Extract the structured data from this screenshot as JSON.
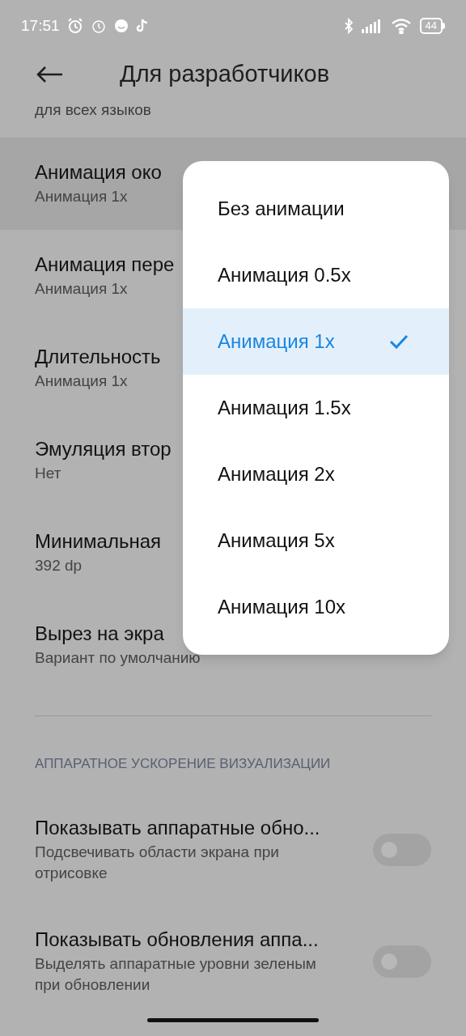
{
  "status_bar": {
    "time": "17:51",
    "battery": "44"
  },
  "header": {
    "title": "Для разработчиков"
  },
  "cut_text": "для всех языков",
  "settings": [
    {
      "title": "Анимация око",
      "value": "Анимация 1x",
      "pressed": true
    },
    {
      "title": "Анимация пере",
      "value": "Анимация 1x",
      "pressed": false
    },
    {
      "title": "Длительность",
      "value": "Анимация 1x",
      "pressed": false
    },
    {
      "title": "Эмуляция втор",
      "value": "Нет",
      "pressed": false
    },
    {
      "title": "Минимальная",
      "value": "392 dp",
      "pressed": false
    },
    {
      "title": "Вырез на экра",
      "value": "Вариант по умолчанию",
      "pressed": false
    }
  ],
  "section_header": "АППАРАТНОЕ УСКОРЕНИЕ ВИЗУАЛИЗАЦИИ",
  "toggles": [
    {
      "title": "Показывать аппаратные обно...",
      "description": "Подсвечивать области экрана при отрисовке",
      "on": false
    },
    {
      "title": "Показывать обновления аппа...",
      "description": "Выделять аппаратные уровни зеленым при обновлении",
      "on": false
    }
  ],
  "popup": {
    "options": [
      {
        "label": "Без анимации",
        "selected": false
      },
      {
        "label": "Анимация 0.5x",
        "selected": false
      },
      {
        "label": "Анимация 1x",
        "selected": true
      },
      {
        "label": "Анимация 1.5x",
        "selected": false
      },
      {
        "label": "Анимация 2x",
        "selected": false
      },
      {
        "label": "Анимация 5x",
        "selected": false
      },
      {
        "label": "Анимация 10x",
        "selected": false
      }
    ]
  }
}
